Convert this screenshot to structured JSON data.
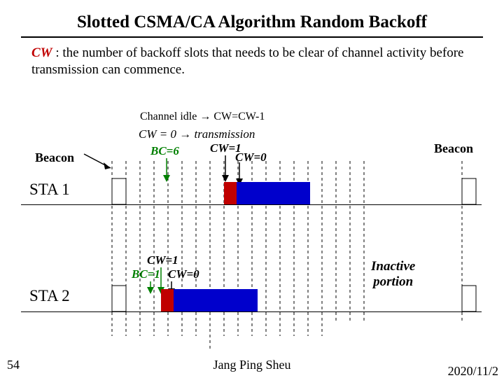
{
  "title": "Slotted CSMA/CA Algorithm Random Backoff",
  "definition": {
    "cw": "CW",
    "rest": " :  the number of backoff slots that needs to be clear of channel activity before transmission can commence."
  },
  "labels": {
    "channel_idle": "Channel idle   → CW=CW-1",
    "cw0_tx": "CW = 0   → transmission",
    "bc6": "BC=6",
    "cw1_top": "CW=1",
    "cw0_top": "CW=0",
    "cw1_mid": "CW=1",
    "bc1": "BC=1",
    "cw0_mid": "CW=0",
    "beacon_left": "Beacon",
    "beacon_right": "Beacon",
    "inactive1": "Inactive",
    "inactive2": "portion",
    "sta1": "STA 1",
    "sta2": "STA 2"
  },
  "footer": {
    "page": "54",
    "author": "Jang Ping Sheu",
    "date": "2020/11/2"
  },
  "chart_data": {
    "type": "diagram",
    "description": "Timing diagram of slotted CSMA/CA random backoff for two stations between beacons",
    "stations": [
      "STA 1",
      "STA 2"
    ],
    "sta1": {
      "backoff_counter": 6,
      "cw_sequence": [
        1,
        0
      ],
      "transmit_slots": 6
    },
    "sta2": {
      "backoff_counter": 1,
      "cw_sequence": [
        1,
        0
      ],
      "transmit_slots": 7
    },
    "events": [
      "Beacon",
      "Backoff countdown (channel idle → CW=CW-1)",
      "CW=0 → transmission",
      "Inactive portion",
      "Beacon"
    ]
  }
}
